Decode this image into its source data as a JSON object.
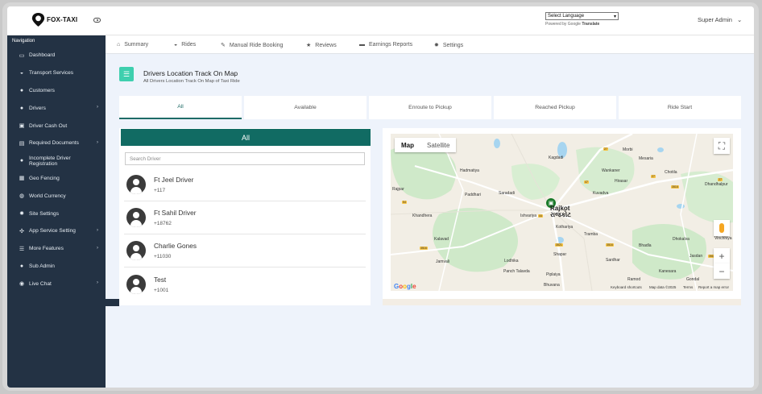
{
  "header": {
    "logo_text": "FOX-TAXI",
    "language_select": "Select Language",
    "powered_by": "Powered by",
    "google": "Google",
    "translate": "Translate",
    "user_name": "Super Admin",
    "user_caret": "⌄"
  },
  "sidebar": {
    "title": "Navigation",
    "items": [
      {
        "label": "Dashboard",
        "icon": "dashboard-icon",
        "chevron": ""
      },
      {
        "label": "Transport Services",
        "icon": "car-icon",
        "chevron": ""
      },
      {
        "label": "Customers",
        "icon": "users-icon",
        "chevron": ""
      },
      {
        "label": "Drivers",
        "icon": "driver-icon",
        "chevron": "›"
      },
      {
        "label": "Driver Cash Out",
        "icon": "cash-icon",
        "chevron": ""
      },
      {
        "label": "Required Documents",
        "icon": "document-icon",
        "chevron": "›"
      },
      {
        "label": "Incomplete Driver Registration",
        "icon": "user-add-icon",
        "chevron": ""
      },
      {
        "label": "Geo Fencing",
        "icon": "map-icon",
        "chevron": ""
      },
      {
        "label": "World Currency",
        "icon": "globe-icon",
        "chevron": ""
      },
      {
        "label": "Site Settings",
        "icon": "gear-icon",
        "chevron": ""
      },
      {
        "label": "App Service Setting",
        "icon": "wrench-icon",
        "chevron": "›"
      },
      {
        "label": "More Features",
        "icon": "list-icon",
        "chevron": "›"
      },
      {
        "label": "Sub Admin",
        "icon": "admin-icon",
        "chevron": ""
      },
      {
        "label": "Live Chat",
        "icon": "chat-icon",
        "chevron": "›"
      }
    ]
  },
  "subnav": {
    "items": [
      {
        "label": "Summary",
        "icon": "home-icon"
      },
      {
        "label": "Rides",
        "icon": "car-icon"
      },
      {
        "label": "Manual Ride Booking",
        "icon": "edit-icon"
      },
      {
        "label": "Reviews",
        "icon": "star-icon"
      },
      {
        "label": "Earnings Reports",
        "icon": "money-icon"
      },
      {
        "label": "Settings",
        "icon": "gear-icon"
      }
    ]
  },
  "page": {
    "title": "Drivers Location Track On Map",
    "subtitle": "All Drivers Location Track On Map of Taxi Ride"
  },
  "filters": [
    {
      "label": "All",
      "active": true
    },
    {
      "label": "Available",
      "active": false
    },
    {
      "label": "Enroute to Pickup",
      "active": false
    },
    {
      "label": "Reached Pickup",
      "active": false
    },
    {
      "label": "Ride Start",
      "active": false
    }
  ],
  "driver_list": {
    "title": "All",
    "search_placeholder": "Search Driver",
    "drivers": [
      {
        "name": "Ft Jeel Driver",
        "phone": "+117"
      },
      {
        "name": "Ft Sahil Driver",
        "phone": "+18762"
      },
      {
        "name": "Charlie Gones",
        "phone": "+11030"
      },
      {
        "name": "Test",
        "phone": "+1001"
      }
    ]
  },
  "map": {
    "map_label": "Map",
    "satellite_label": "Satellite",
    "city_en": "Rajkot",
    "city_local": "રાજકોટ",
    "footer_shortcuts": "Keyboard shortcuts",
    "footer_data": "Map data ©2025",
    "footer_terms": "Terms",
    "footer_report": "Report a map error",
    "places": [
      "Kagdadi",
      "Mesaria",
      "Morbi",
      "Chotila",
      "Wankaner",
      "Hadmatiya",
      "Hirasar",
      "Dhandhalpur",
      "Rajpar",
      "Paddhari",
      "Saradadi",
      "Kuvadva",
      "Khandhera",
      "Ishvariya",
      "Kothariya",
      "Kalavad",
      "Tramba",
      "Bhadla",
      "Dhokalva",
      "Vinchhiya",
      "Jamvali",
      "Lodhika",
      "Shapar",
      "Sardhar",
      "Kanesara",
      "Jasdan",
      "Panch Talavda",
      "Bhuvana",
      "Piplaiya",
      "Gondal",
      "Ramod"
    ],
    "highway_markers": [
      "27",
      "27",
      "47",
      "27",
      "3516",
      "44",
      "54",
      "3516",
      "3521",
      "3516",
      "3511"
    ],
    "colors": {
      "water": "#a7d5f0",
      "green": "#cfe9c9",
      "road": "#ffffff",
      "highway": "#f6c343"
    }
  },
  "colors": {
    "sidebar": "#233244",
    "accent": "#116b63",
    "page_icon": "#3ecfae"
  }
}
